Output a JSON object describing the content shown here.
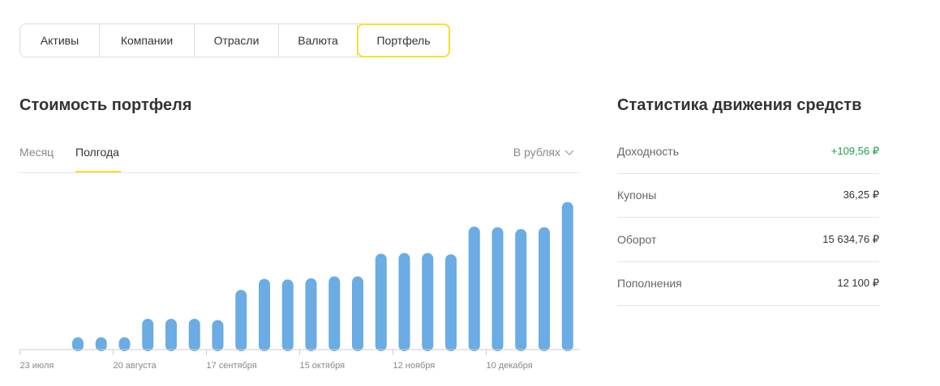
{
  "nav_tabs": [
    {
      "label": "Активы"
    },
    {
      "label": "Компании"
    },
    {
      "label": "Отрасли"
    },
    {
      "label": "Валюта"
    },
    {
      "label": "Портфель"
    }
  ],
  "active_tab": "Портфель",
  "portfolio": {
    "title": "Стоимость портфеля",
    "periods": [
      "Месяц",
      "Полгода"
    ],
    "active_period": "Полгода",
    "currency_selector": "В рублях",
    "currency_icon": "chevron-down-icon"
  },
  "stats": {
    "title": "Статистика движения средств",
    "rows": [
      {
        "label": "Доходность",
        "value": "+109,56 ₽",
        "positive": true
      },
      {
        "label": "Купоны",
        "value": "36,25 ₽"
      },
      {
        "label": "Оборот",
        "value": "15 634,76 ₽"
      },
      {
        "label": "Пополнения",
        "value": "12 100 ₽"
      }
    ]
  },
  "colors": {
    "accent": "#ffdd2d",
    "bar": "#6aace3",
    "positive": "#1e9e47"
  },
  "chart_data": {
    "type": "bar",
    "x_tick_labels": [
      "23 июля",
      "20 августа",
      "17 сентября",
      "15 октября",
      "12 ноября",
      "10 декабря"
    ],
    "values": [
      0,
      0,
      1000,
      1000,
      1000,
      2500,
      2500,
      2500,
      2400,
      4850,
      5750,
      5700,
      5800,
      5950,
      5950,
      7800,
      7850,
      7850,
      7750,
      10000,
      9950,
      9800,
      9950,
      12000
    ],
    "ylim": [
      0,
      12500
    ],
    "grid": false
  }
}
